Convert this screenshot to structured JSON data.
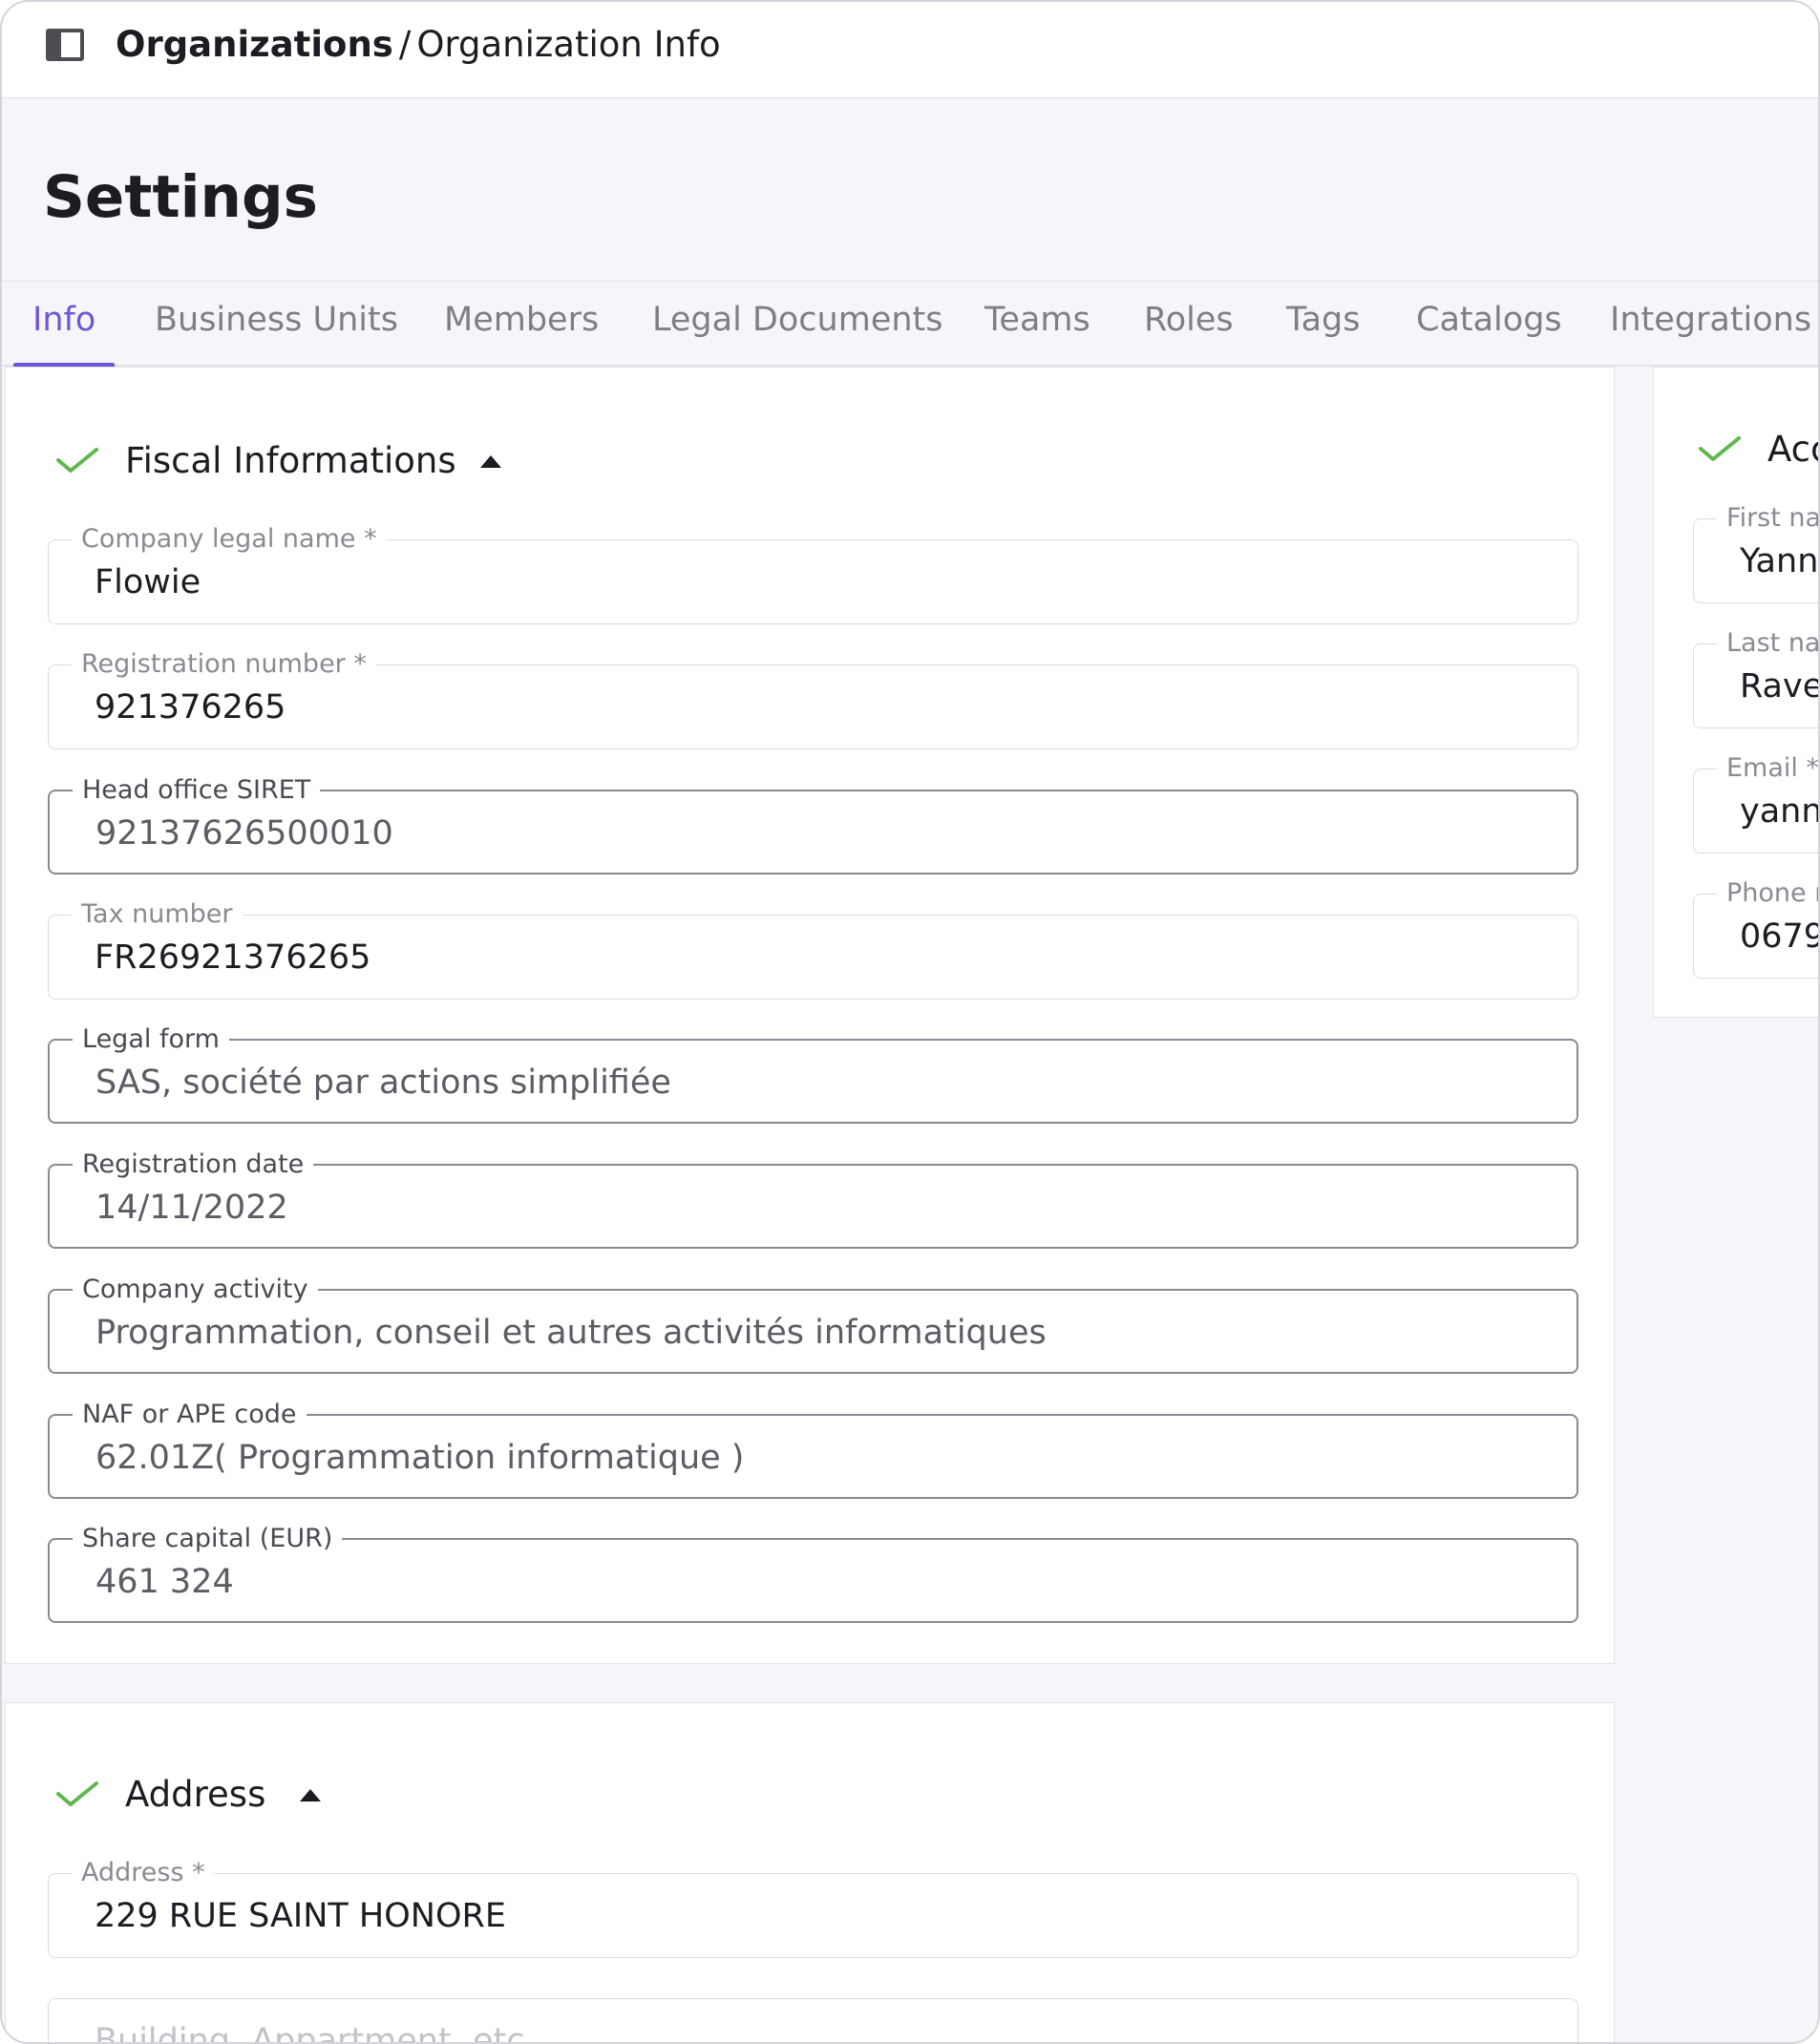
{
  "breadcrumb": {
    "root": "Organizations",
    "separator": "/",
    "current": "Organization Info"
  },
  "page": {
    "title": "Settings"
  },
  "tabs": [
    {
      "label": "Info",
      "active": true
    },
    {
      "label": "Business Units",
      "active": false
    },
    {
      "label": "Members",
      "active": false
    },
    {
      "label": "Legal Documents",
      "active": false
    },
    {
      "label": "Teams",
      "active": false
    },
    {
      "label": "Roles",
      "active": false
    },
    {
      "label": "Tags",
      "active": false
    },
    {
      "label": "Catalogs",
      "active": false
    },
    {
      "label": "Integrations",
      "active": false
    }
  ],
  "fiscal": {
    "title": "Fiscal Informations",
    "fields": [
      {
        "label": "Company legal name *",
        "value": "Flowie",
        "editable": false
      },
      {
        "label": "Registration number *",
        "value": "921376265",
        "editable": false
      },
      {
        "label": "Head office SIRET",
        "value": "92137626500010",
        "editable": true
      },
      {
        "label": "Tax number",
        "value": "FR26921376265",
        "editable": false
      },
      {
        "label": "Legal form",
        "value": "SAS, société par actions simplifiée",
        "editable": true
      },
      {
        "label": "Registration date",
        "value": "14/11/2022",
        "editable": true
      },
      {
        "label": "Company activity",
        "value": "Programmation, conseil et autres activités informatiques",
        "editable": true
      },
      {
        "label": "NAF or APE code",
        "value": "62.01Z( Programmation informatique )",
        "editable": true
      },
      {
        "label": "Share capital (EUR)",
        "value": "461 324",
        "editable": true
      }
    ]
  },
  "account": {
    "title": "Acc",
    "fields": [
      {
        "label": "First nar",
        "value": "Yann"
      },
      {
        "label": "Last nar",
        "value": "Rave"
      },
      {
        "label": "Email *",
        "value": "yann"
      },
      {
        "label": "Phone n",
        "value": "0679"
      }
    ]
  },
  "address": {
    "title": "Address",
    "address_label": "Address *",
    "address_value": "229 RUE SAINT HONORE",
    "building_placeholder": "Building, Appartment, etc"
  },
  "colors": {
    "accent": "#6e57d2",
    "check": "#5fb84f",
    "background": "#f6f6fa"
  }
}
